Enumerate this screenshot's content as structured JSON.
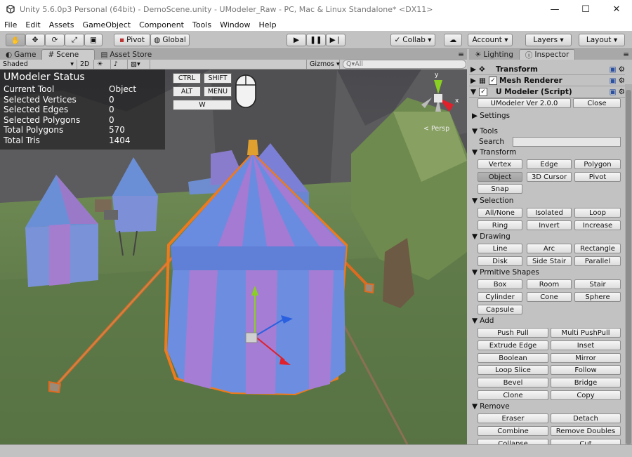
{
  "window": {
    "title": "Unity 5.6.0p3 Personal (64bit) - DemoScene.unity - UModeler_Raw - PC, Mac & Linux Standalone* <DX11>",
    "min": "—",
    "max": "☐",
    "close": "✕"
  },
  "menu": [
    "File",
    "Edit",
    "Assets",
    "GameObject",
    "Component",
    "Tools",
    "Window",
    "Help"
  ],
  "toolbar": {
    "pivot": "Pivot",
    "global": "Global",
    "collab": "Collab ▾",
    "account": "Account ▾",
    "layers": "Layers ▾",
    "layout": "Layout ▾"
  },
  "tabs": {
    "game": "Game",
    "scene": "Scene",
    "asset_store": "Asset Store",
    "lighting": "Lighting",
    "inspector": "Inspector"
  },
  "scenebar": {
    "shading": "Shaded",
    "mode2d": "2D",
    "gizmos": "Gizmos ▾",
    "search_placeholder": "Q▾All"
  },
  "status": {
    "title": "UModeler Status",
    "rows": [
      {
        "k": "Current Tool",
        "v": "Object"
      },
      {
        "k": "Selected Vertices",
        "v": "0"
      },
      {
        "k": "Selected Edges",
        "v": "0"
      },
      {
        "k": "Selected Polygons",
        "v": "0"
      },
      {
        "k": "Total Polygons",
        "v": "570"
      },
      {
        "k": "Total Tris",
        "v": "1404"
      }
    ]
  },
  "keys": {
    "ctrl": "CTRL",
    "shift": "SHIFT",
    "alt": "ALT",
    "menu": "MENU",
    "w": "W"
  },
  "gizmo": {
    "persp": "< Persp",
    "y": "y",
    "x": "x"
  },
  "inspector": {
    "components": [
      "Transform",
      "Mesh Renderer",
      "U Modeler (Script)"
    ],
    "version": "UModeler Ver 2.0.0",
    "close": "Close",
    "settings": "Settings",
    "tools": "Tools",
    "search_label": "Search",
    "sections": {
      "transform": {
        "label": "Transform",
        "buttons": [
          "Vertex",
          "Edge",
          "Polygon",
          "Object",
          "3D Cursor",
          "Pivot",
          "Snap"
        ]
      },
      "selection": {
        "label": "Selection",
        "buttons": [
          "All/None",
          "Isolated",
          "Loop",
          "Ring",
          "Invert",
          "Increase"
        ]
      },
      "drawing": {
        "label": "Drawing",
        "buttons": [
          "Line",
          "Arc",
          "Rectangle",
          "Disk",
          "Side Stair",
          "Parallel"
        ]
      },
      "primitive": {
        "label": "Prmitive Shapes",
        "buttons": [
          "Box",
          "Room",
          "Stair",
          "Cylinder",
          "Cone",
          "Sphere",
          "Capsule"
        ]
      },
      "add": {
        "label": "Add",
        "buttons": [
          "Push Pull",
          "Multi PushPull",
          "Extrude Edge",
          "Inset",
          "Boolean",
          "Mirror",
          "Loop Slice",
          "Follow",
          "Bevel",
          "Bridge",
          "Clone",
          "Copy"
        ]
      },
      "remove": {
        "label": "Remove",
        "buttons": [
          "Eraser",
          "Detach",
          "Combine",
          "Remove Doubles",
          "Collapse",
          "Cut"
        ]
      }
    }
  }
}
